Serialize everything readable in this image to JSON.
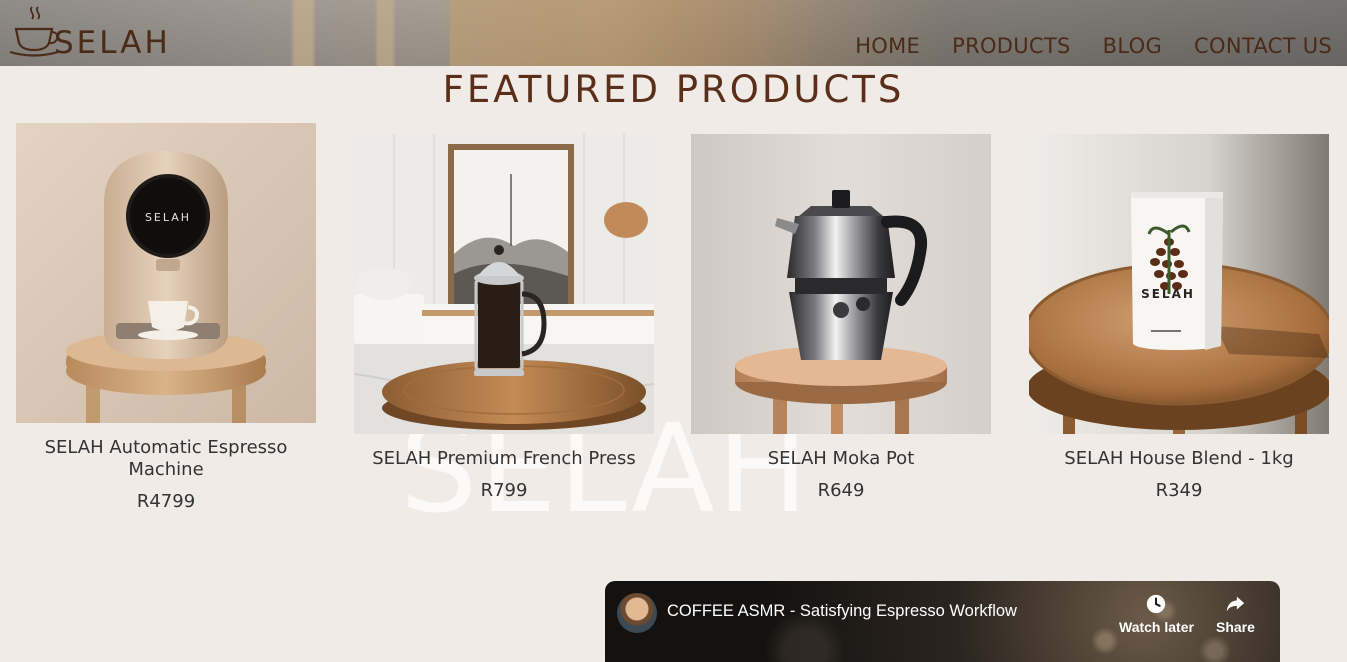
{
  "brand": {
    "logo_text": "SELAH"
  },
  "nav": [
    {
      "label": "HOME"
    },
    {
      "label": "PRODUCTS"
    },
    {
      "label": "BLOG"
    },
    {
      "label": "CONTACT US"
    }
  ],
  "section_title": "FEATURED PRODUCTS",
  "watermark_text": "SELAH",
  "products": [
    {
      "name": "SELAH Automatic Espresso Machine",
      "price": "R4799",
      "image": "espresso-machine"
    },
    {
      "name": "SELAH Premium French Press",
      "price": "R799",
      "image": "french-press"
    },
    {
      "name": "SELAH Moka Pot",
      "price": "R649",
      "image": "moka-pot"
    },
    {
      "name": "SELAH House Blend - 1kg",
      "price": "R349",
      "image": "coffee-bag"
    }
  ],
  "video": {
    "title": "COFFEE ASMR - Satisfying Espresso Workflow",
    "watch_later_label": "Watch later",
    "share_label": "Share"
  },
  "colors": {
    "brand_brown": "#5a2e18",
    "background": "#f0ebe6"
  }
}
